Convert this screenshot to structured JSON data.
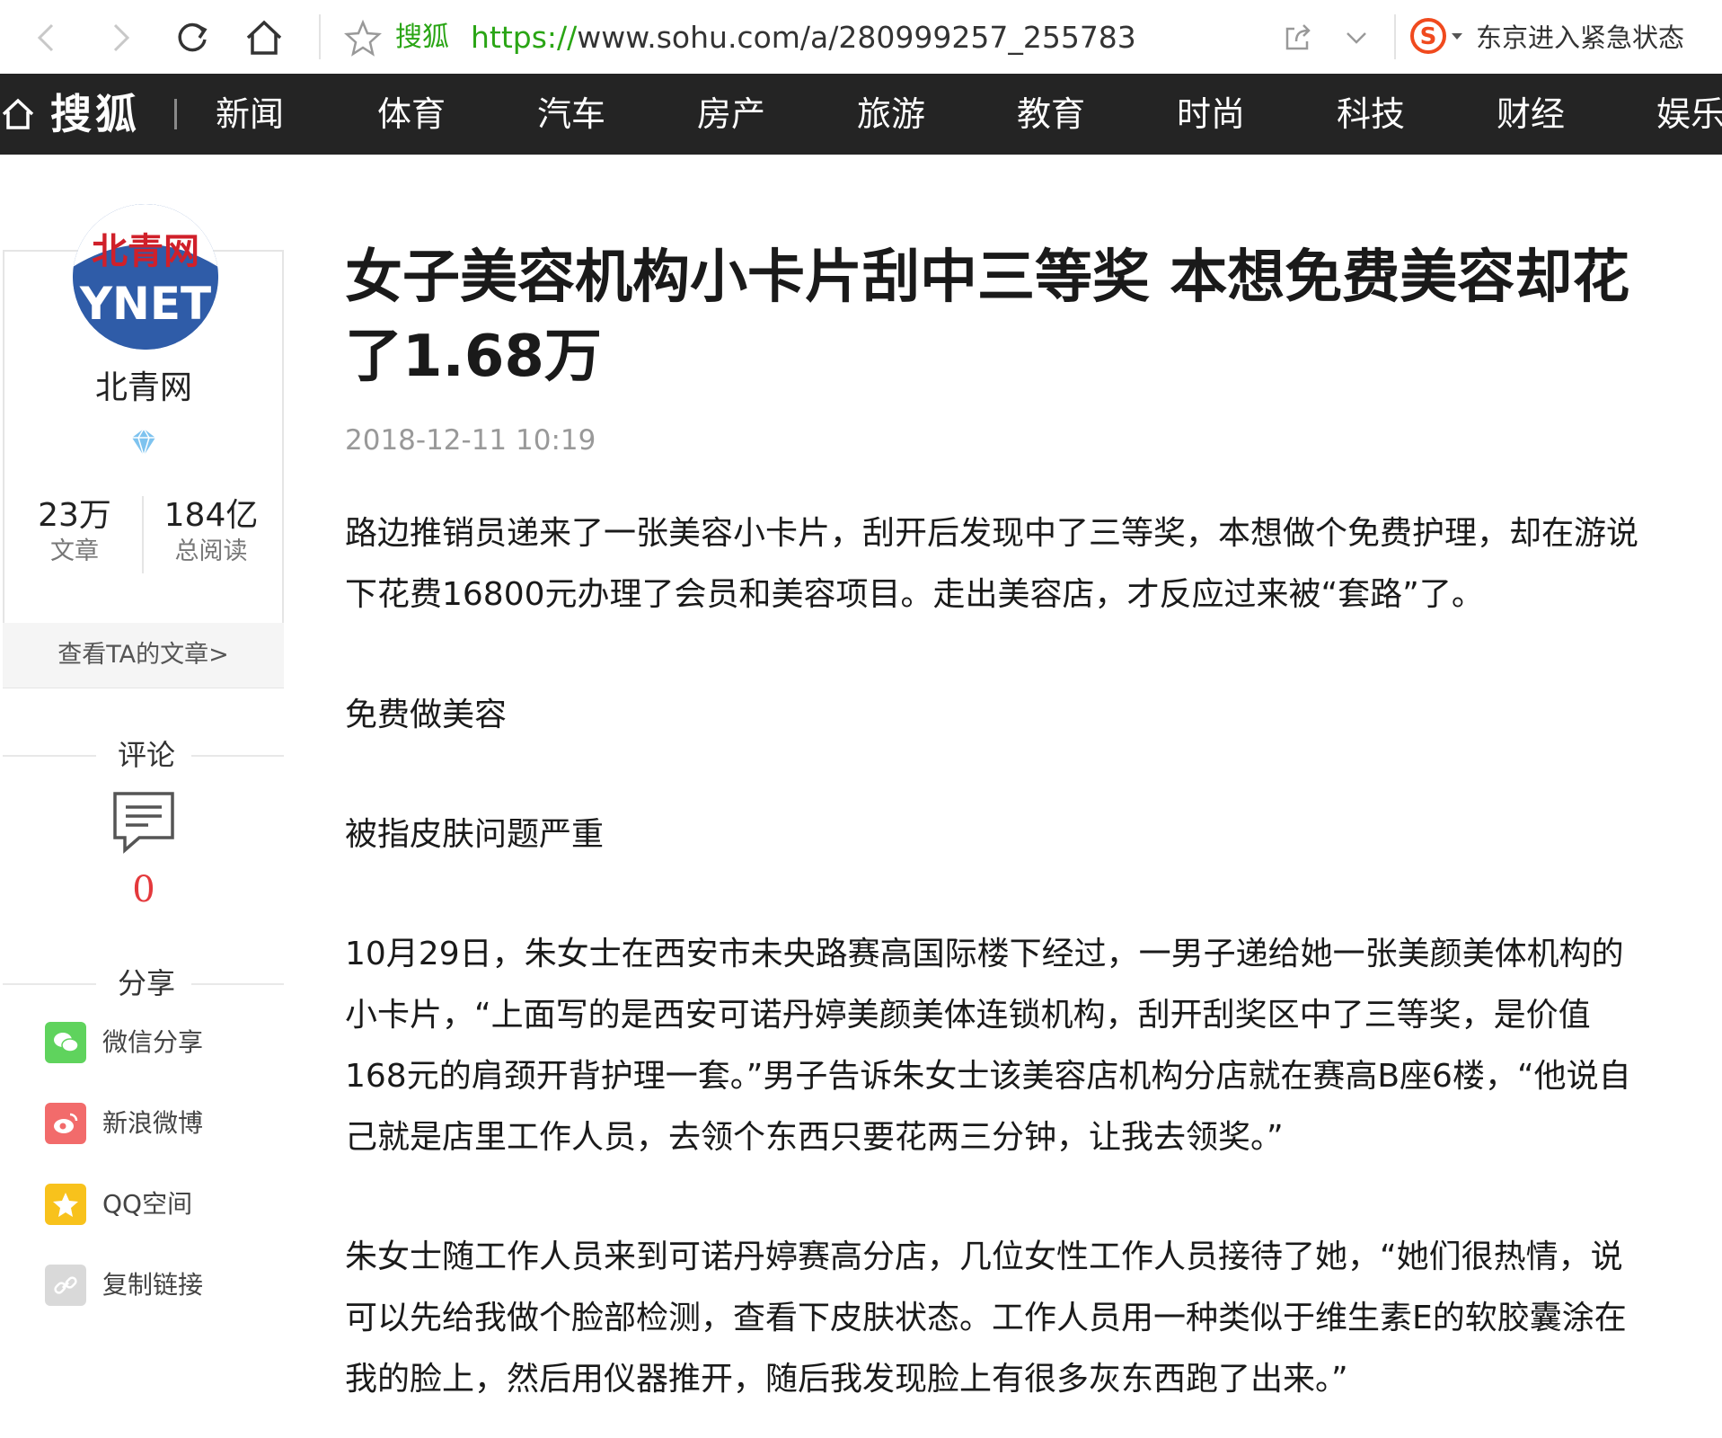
{
  "browser": {
    "site_name": "搜狐",
    "url_protocol": "https://",
    "url_rest": "www.sohu.com/a/280999257_255783",
    "news_hint": "东京进入紧急状态"
  },
  "site_nav": {
    "brand": "搜狐",
    "items": [
      "新闻",
      "体育",
      "汽车",
      "房产",
      "旅游",
      "教育",
      "时尚",
      "科技",
      "财经",
      "娱乐"
    ]
  },
  "author": {
    "logo_top": "北青网",
    "logo_bottom": "YNET",
    "name": "北青网",
    "articles_value": "23万",
    "articles_label": "文章",
    "reads_value": "184亿",
    "reads_label": "总阅读",
    "view_link": "查看TA的文章>"
  },
  "comments": {
    "heading": "评论",
    "count": "0"
  },
  "share": {
    "heading": "分享",
    "items": [
      {
        "label": "微信分享",
        "color": "#5fd35d"
      },
      {
        "label": "新浪微博",
        "color": "#f26b6b"
      },
      {
        "label": "QQ空间",
        "color": "#f8c21c"
      },
      {
        "label": "复制链接",
        "color": "#d9d9d9"
      }
    ]
  },
  "article": {
    "title": "女子美容机构小卡片刮中三等奖 本想免费美容却花了1.68万",
    "time": "2018-12-11 10:19",
    "paragraphs": [
      "路边推销员递来了一张美容小卡片，刮开后发现中了三等奖，本想做个免费护理，却在游说下花费16800元办理了会员和美容项目。走出美容店，才反应过来被“套路”了。",
      "免费做美容",
      "被指皮肤问题严重",
      "10月29日，朱女士在西安市未央路赛高国际楼下经过，一男子递给她一张美颜美体机构的小卡片，“上面写的是西安可诺丹婷美颜美体连锁机构，刮开刮奖区中了三等奖，是价值168元的肩颈开背护理一套。”男子告诉朱女士该美容店机构分店就在赛高B座6楼，“他说自己就是店里工作人员，去领个东西只要花两三分钟，让我去领奖。”",
      "朱女士随工作人员来到可诺丹婷赛高分店，几位女性工作人员接待了她，“她们很热情，说可以先给我做个脸部检测，查看下皮肤状态。工作人员用一种类似于维生素E的软胶囊涂在我的脸上，然后用仪器推开，随后我发现脸上有很多灰东西跑了出来。”"
    ]
  }
}
